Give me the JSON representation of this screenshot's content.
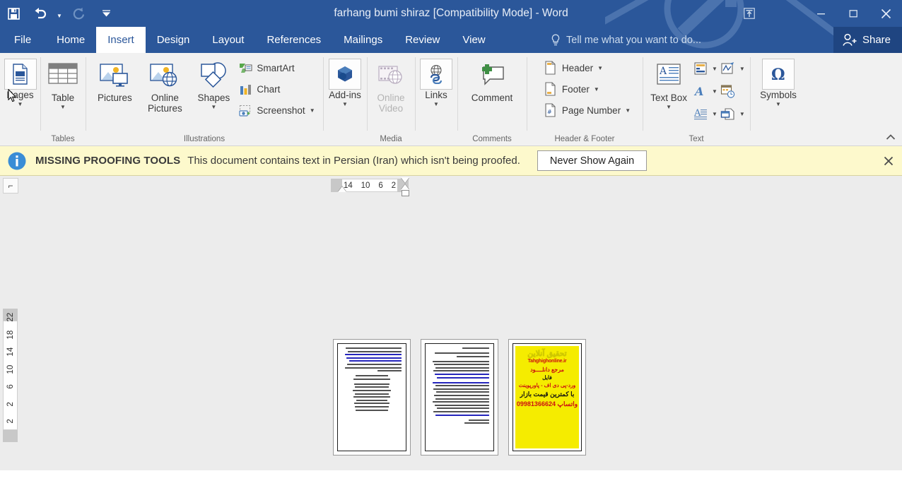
{
  "window": {
    "title": "farhang bumi shiraz [Compatibility Mode] - Word",
    "quick_access": [
      {
        "name": "save",
        "label": "Save",
        "icon": "save-icon",
        "enabled": true
      },
      {
        "name": "undo",
        "label": "Undo",
        "icon": "undo-icon",
        "enabled": true
      },
      {
        "name": "redo",
        "label": "Redo",
        "icon": "redo-icon",
        "enabled": false
      },
      {
        "name": "customize",
        "label": "Customize Quick Access Toolbar",
        "icon": "chevron-down-icon",
        "enabled": true
      }
    ],
    "controls": {
      "ribbon_display_options": "Ribbon Display Options",
      "minimize": "Minimize",
      "restore": "Restore Down",
      "close": "Close"
    }
  },
  "ribbon": {
    "tabs": [
      {
        "label": "File",
        "active": false
      },
      {
        "label": "Home",
        "active": false
      },
      {
        "label": "Insert",
        "active": true
      },
      {
        "label": "Design",
        "active": false
      },
      {
        "label": "Layout",
        "active": false
      },
      {
        "label": "References",
        "active": false
      },
      {
        "label": "Mailings",
        "active": false
      },
      {
        "label": "Review",
        "active": false
      },
      {
        "label": "View",
        "active": false
      }
    ],
    "tell_me": "Tell me what you want to do...",
    "share": "Share",
    "collapse": "Collapse the Ribbon",
    "groups": [
      {
        "label": "",
        "items": [
          {
            "label": "Pages",
            "icon": "pages-icon",
            "caret": true,
            "enabled": true
          }
        ]
      },
      {
        "label": "Tables",
        "items": [
          {
            "label": "Table",
            "icon": "table-icon",
            "caret": true,
            "enabled": true
          }
        ]
      },
      {
        "label": "Illustrations",
        "items": [
          {
            "label": "Pictures",
            "icon": "pictures-icon",
            "caret": false,
            "enabled": true
          },
          {
            "label": "Online Pictures",
            "icon": "online-pictures-icon",
            "caret": false,
            "enabled": true
          },
          {
            "label": "Shapes",
            "icon": "shapes-icon",
            "caret": true,
            "enabled": true
          },
          {
            "label": "SmartArt",
            "icon": "smartart-icon",
            "caret": false,
            "enabled": true
          },
          {
            "label": "Chart",
            "icon": "chart-icon",
            "caret": false,
            "enabled": true
          },
          {
            "label": "Screenshot",
            "icon": "screenshot-icon",
            "caret": true,
            "enabled": true
          }
        ]
      },
      {
        "label": "",
        "items": [
          {
            "label": "Add-ins",
            "icon": "addins-icon",
            "caret": true,
            "enabled": true
          }
        ]
      },
      {
        "label": "Media",
        "items": [
          {
            "label": "Online Video",
            "icon": "online-video-icon",
            "caret": false,
            "enabled": false
          }
        ]
      },
      {
        "label": "",
        "items": [
          {
            "label": "Links",
            "icon": "links-icon",
            "caret": true,
            "enabled": true
          }
        ]
      },
      {
        "label": "Comments",
        "items": [
          {
            "label": "Comment",
            "icon": "comment-icon",
            "caret": false,
            "enabled": true
          }
        ]
      },
      {
        "label": "Header & Footer",
        "items": [
          {
            "label": "Header",
            "icon": "header-icon",
            "caret": true,
            "enabled": true
          },
          {
            "label": "Footer",
            "icon": "footer-icon",
            "caret": true,
            "enabled": true
          },
          {
            "label": "Page Number",
            "icon": "page-number-icon",
            "caret": true,
            "enabled": true
          }
        ]
      },
      {
        "label": "Text",
        "items": [
          {
            "label": "Text Box",
            "icon": "text-box-icon",
            "caret": true,
            "enabled": true
          },
          {
            "label": "Quick Parts",
            "icon": "quick-parts-icon",
            "caret": true,
            "enabled": true
          },
          {
            "label": "WordArt",
            "icon": "wordart-icon",
            "caret": true,
            "enabled": true
          },
          {
            "label": "Drop Cap",
            "icon": "drop-cap-icon",
            "caret": true,
            "enabled": true
          },
          {
            "label": "Signature Line",
            "icon": "signature-line-icon",
            "caret": true,
            "enabled": true
          },
          {
            "label": "Date & Time",
            "icon": "date-time-icon",
            "caret": false,
            "enabled": true
          },
          {
            "label": "Object",
            "icon": "object-icon",
            "caret": true,
            "enabled": true
          }
        ]
      },
      {
        "label": "",
        "items": [
          {
            "label": "Symbols",
            "icon": "omega-icon",
            "caret": true,
            "enabled": true
          }
        ]
      }
    ]
  },
  "message_bar": {
    "icon": "info-icon",
    "heading": "MISSING PROOFING TOOLS",
    "text": "This document contains text in Persian (Iran) which isn't being proofed.",
    "button": "Never Show Again",
    "close": "×",
    "background": "#fdf9cc"
  },
  "rulers": {
    "tab_stop_selector": "⌐",
    "horizontal_numbers": [
      "14",
      "10",
      "6",
      "2"
    ],
    "vertical_numbers": [
      "2",
      "2",
      "6",
      "10",
      "14",
      "18",
      "22"
    ]
  },
  "document": {
    "zoom_view": "multi-page-thumbnails",
    "pages": [
      {
        "name": "page-1",
        "type": "text",
        "lines": [
          {
            "w": 96,
            "blue": false
          },
          {
            "w": 92,
            "blue": false
          },
          {
            "w": 95,
            "blue": true
          },
          {
            "w": 94,
            "blue": true
          },
          {
            "w": 93,
            "blue": true
          },
          {
            "w": 90,
            "blue": false
          },
          {
            "w": 95,
            "blue": false
          },
          {
            "w": 88,
            "blue": false
          },
          {
            "w": 40,
            "blue": false
          }
        ]
      },
      {
        "name": "page-2",
        "type": "text",
        "lines": [
          {
            "w": 45,
            "blue": false
          },
          {
            "w": 95,
            "blue": false
          },
          {
            "w": 70,
            "blue": false
          },
          {
            "w": 93,
            "blue": false
          },
          {
            "w": 96,
            "blue": false
          },
          {
            "w": 94,
            "blue": false
          },
          {
            "w": 90,
            "blue": true
          },
          {
            "w": 92,
            "blue": true
          },
          {
            "w": 88,
            "blue": true
          }
        ]
      },
      {
        "name": "page-3",
        "type": "advertisement",
        "ad": {
          "title": "تحقیق آنلاین",
          "url": "Tahghighonline.ir",
          "line1": "مرجع دانلــــود",
          "line2": "فایل",
          "line3": "ورد-پی دی اف - پاورپوینت",
          "line4": "با کمترین قیمت بازار",
          "line5": "09981366624 واتساپ",
          "background": "#f5ec00"
        }
      }
    ]
  },
  "colors": {
    "word_blue": "#2b579a",
    "share_blue": "#1f4581",
    "ribbon_bg": "#f1f1f1",
    "canvas_bg": "#ececec",
    "message_yellow": "#fdf9cc",
    "accent_icon": "#2b579a"
  }
}
